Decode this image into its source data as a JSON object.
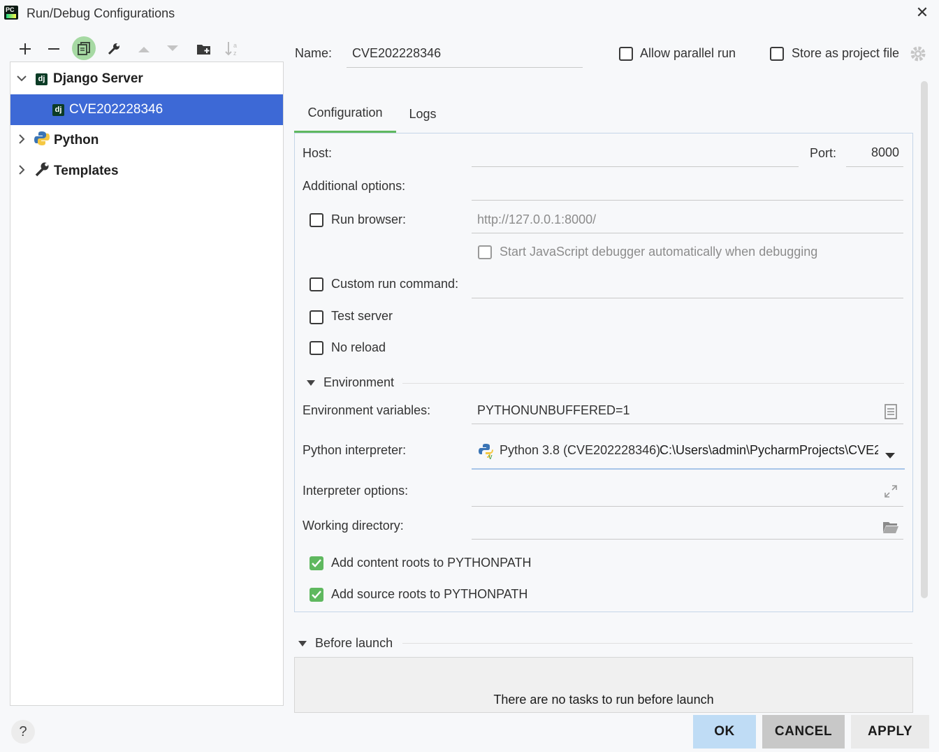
{
  "window": {
    "title": "Run/Debug Configurations",
    "app_icon_text": "PC"
  },
  "tree": {
    "groups": [
      {
        "label": "Django Server",
        "expanded": true,
        "icon": "django-icon",
        "children": [
          {
            "label": "CVE202228346",
            "selected": true,
            "icon": "django-icon"
          }
        ]
      },
      {
        "label": "Python",
        "expanded": false,
        "icon": "python-icon"
      },
      {
        "label": "Templates",
        "expanded": false,
        "icon": "wrench-icon"
      }
    ],
    "django_icon_text": "dj"
  },
  "header": {
    "name_label": "Name:",
    "name_value": "CVE202228346",
    "allow_parallel_label": "Allow parallel run",
    "store_project_label": "Store as project file"
  },
  "tabs": {
    "configuration": "Configuration",
    "logs": "Logs"
  },
  "config": {
    "host_label": "Host:",
    "host_value": "",
    "port_label": "Port:",
    "port_value": "8000",
    "additional_options_label": "Additional options:",
    "run_browser_label": "Run browser:",
    "run_browser_url": "http://127.0.0.1:8000/",
    "js_debugger_label": "Start JavaScript debugger automatically when debugging",
    "custom_run_label": "Custom run command:",
    "test_server_label": "Test server",
    "no_reload_label": "No reload",
    "environment_section": "Environment",
    "env_vars_label": "Environment variables:",
    "env_vars_value": "PYTHONUNBUFFERED=1",
    "interpreter_label": "Python interpreter:",
    "interpreter_value": "Python 3.8 (CVE202228346)",
    "interpreter_path": "C:\\Users\\admin\\PycharmProjects\\CVE2",
    "interpreter_options_label": "Interpreter options:",
    "working_dir_label": "Working directory:",
    "content_roots_label": "Add content roots to PYTHONPATH",
    "source_roots_label": "Add source roots to PYTHONPATH",
    "content_roots_checked": true,
    "source_roots_checked": true
  },
  "before_launch": {
    "section": "Before launch",
    "empty_text": "There are no tasks to run before launch"
  },
  "footer": {
    "ok": "OK",
    "cancel": "CANCEL",
    "apply": "APPLY",
    "help": "?"
  },
  "colors": {
    "selection": "#3d69d6",
    "accent_green": "#5fb85f",
    "ok_bg": "#bfdcf5"
  }
}
